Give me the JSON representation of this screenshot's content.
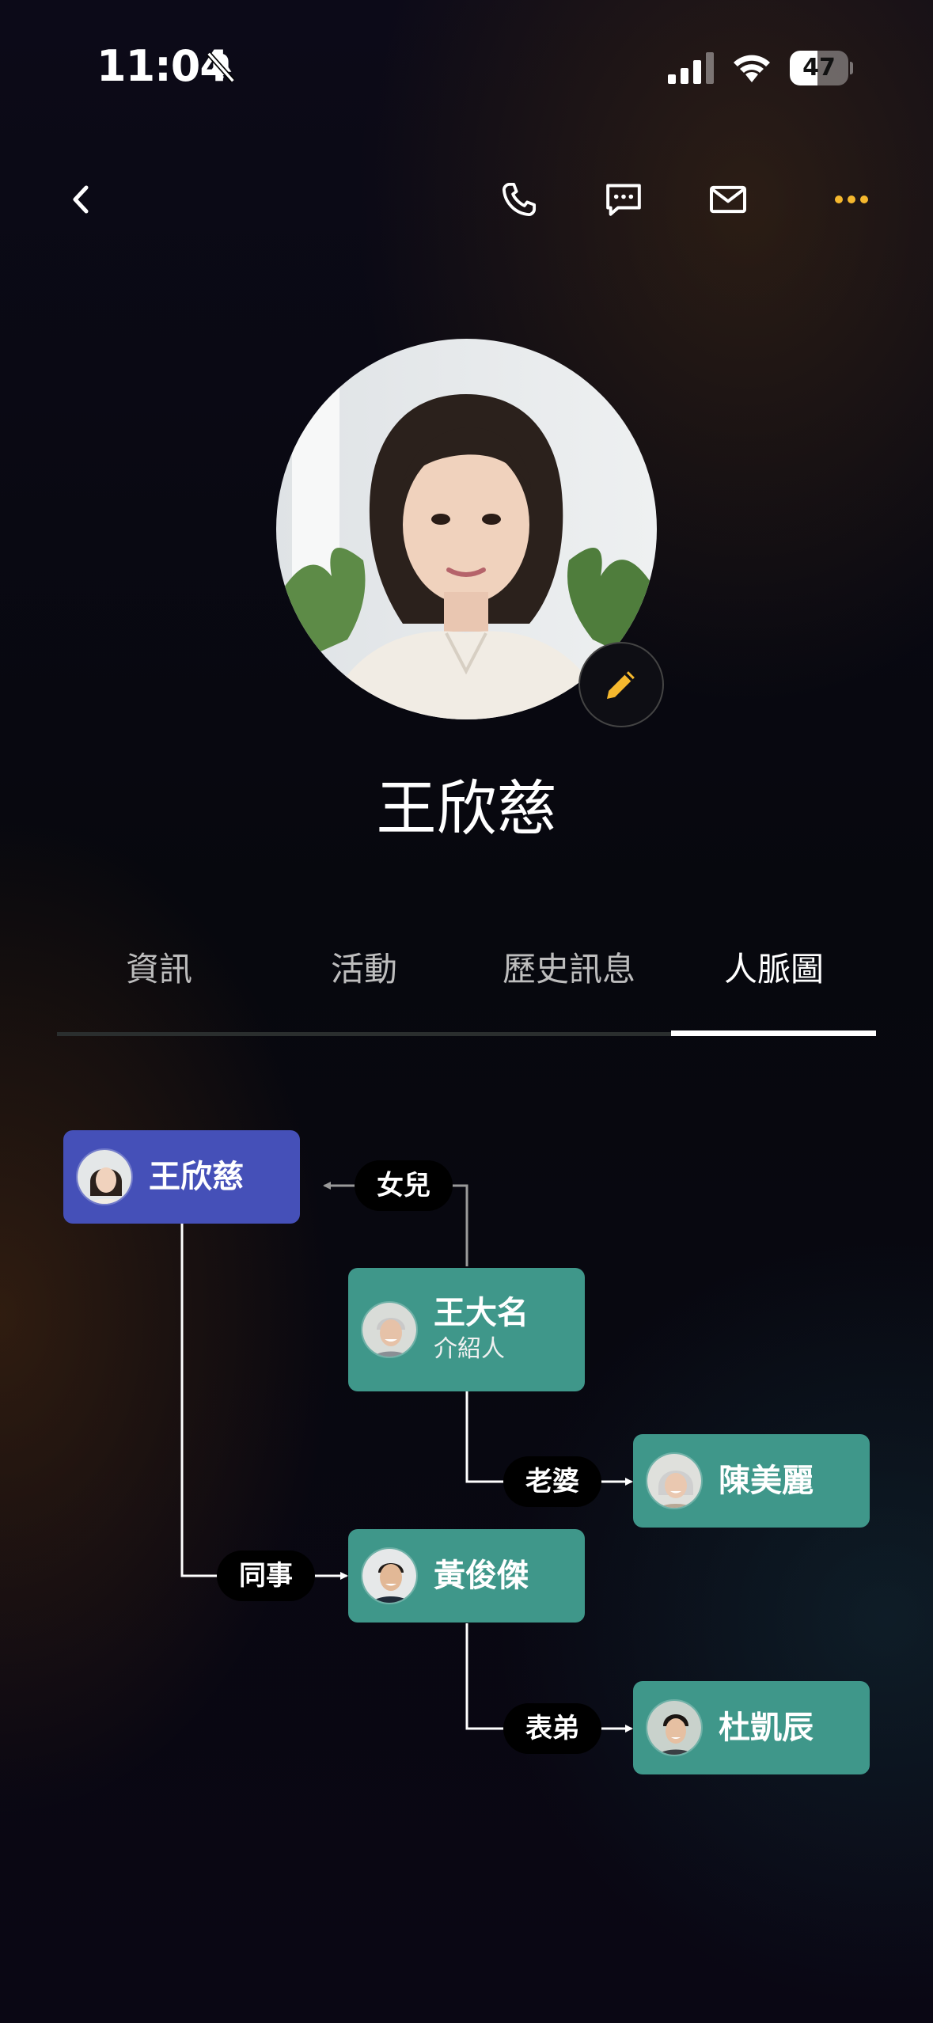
{
  "status_bar": {
    "time": "11:04",
    "battery": "47",
    "battery_level": 0.47
  },
  "nav": {
    "icons": [
      "back-icon",
      "phone-icon",
      "message-icon",
      "mail-icon",
      "more-icon"
    ],
    "accent": "#f5b82e"
  },
  "profile": {
    "name": "王欣慈"
  },
  "tabs": [
    {
      "label": "資訊",
      "active": false
    },
    {
      "label": "活動",
      "active": false
    },
    {
      "label": "歷史訊息",
      "active": false
    },
    {
      "label": "人脈圖",
      "active": true
    }
  ],
  "network": {
    "root": {
      "name": "王欣慈"
    },
    "nodes": [
      {
        "name": "王大名",
        "subtitle": "介紹人",
        "relation": "女兒"
      },
      {
        "name": "陳美麗",
        "relation": "老婆"
      },
      {
        "name": "黃俊傑",
        "relation": "同事"
      },
      {
        "name": "杜凱辰",
        "relation": "表弟"
      }
    ]
  },
  "colors": {
    "root_node": "#4550b8",
    "contact_node": "#3f978a",
    "label_bg": "#000000"
  }
}
